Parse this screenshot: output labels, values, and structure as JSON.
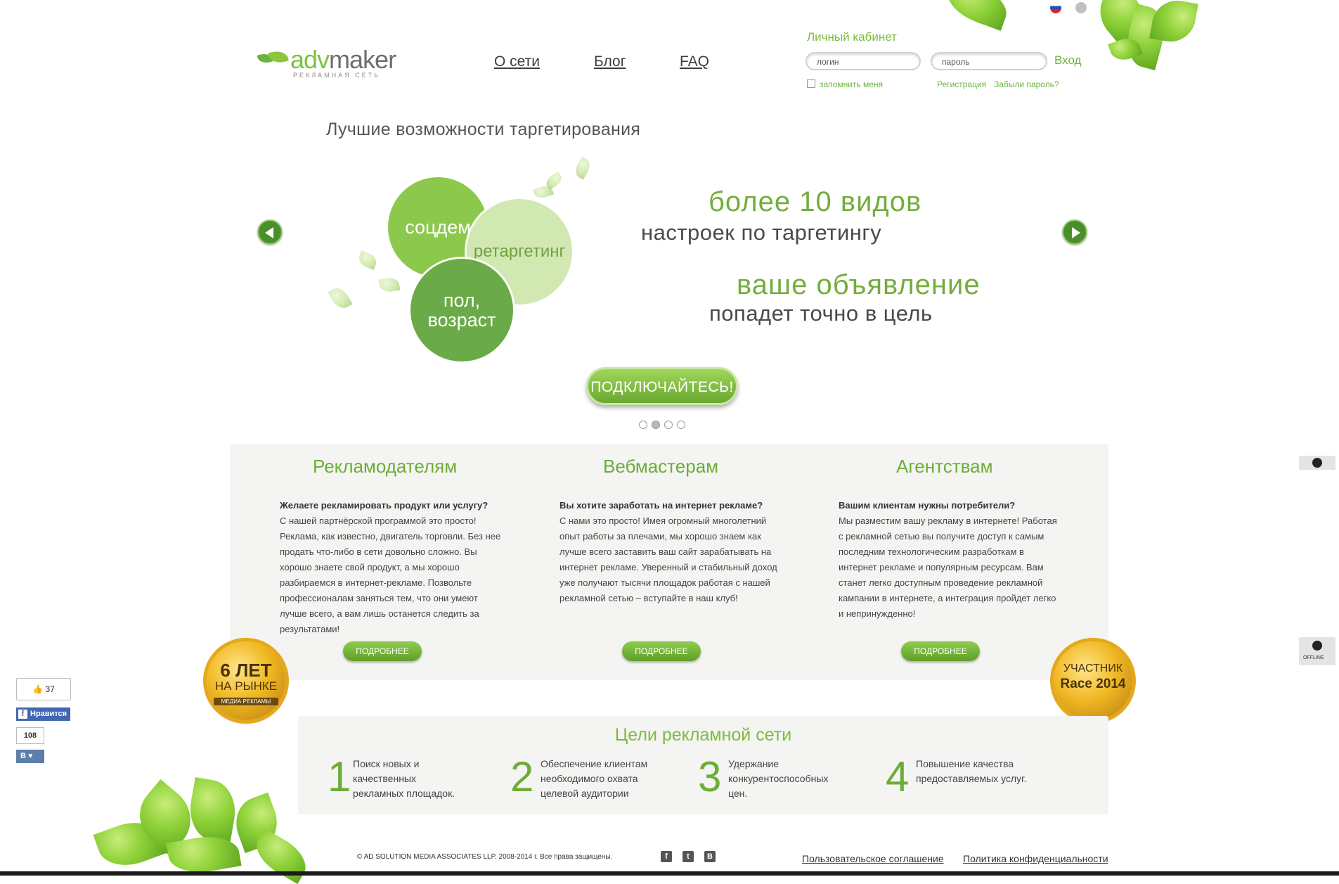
{
  "header": {
    "logo_main_a": "adv",
    "logo_main_b": "maker",
    "logo_sub": "РЕКЛАМНАЯ СЕТЬ",
    "nav": [
      "О сети",
      "Блог",
      "FAQ"
    ],
    "cabinet_title": "Личный кабинет",
    "login_placeholder": "логин",
    "password_placeholder": "пароль",
    "login_button": "Вход",
    "remember": "запомнить меня",
    "register": "Регистрация",
    "forgot": "Забыли пароль?"
  },
  "hero": {
    "title": "Лучшие возможности таргетирования",
    "circles": [
      "соцдем",
      "ретаргетинг",
      "пол,\nвозраст"
    ],
    "line1_big": "более 10 видов",
    "line1_small": "настроек по таргетингу",
    "line2_big": "ваше объявление",
    "line2_small": "попадет точно в цель",
    "cta": "ПОДКЛЮЧАЙТЕСЬ!",
    "slides_total": 4,
    "slide_active": 2
  },
  "columns": [
    {
      "title": "Рекламодателям",
      "lead": "Желаете рекламировать продукт или услугу?",
      "text": "С нашей партнёрской программой это просто! Реклама, как известно, двигатель торговли. Без нее продать что-либо в сети довольно сложно. Вы хорошо знаете свой продукт, а мы хорошо разбираемся в интернет-рекламе. Позвольте профессионалам заняться тем, что они умеют лучше всего, а вам лишь останется следить за результатами!",
      "button": "ПОДРОБНЕЕ"
    },
    {
      "title": "Вебмастерам",
      "lead": "Вы хотите заработать на интернет рекламе?",
      "text": "С нами это просто! Имея огромный многолетний опыт работы за плечами, мы хорошо знаем как лучше всего заставить ваш сайт зарабатывать на интернет рекламе. Уверенный и стабильный доход уже получают тысячи площадок работая с нашей рекламной сетью – вступайте в наш клуб!",
      "button": "ПОДРОБНЕЕ"
    },
    {
      "title": "Агентствам",
      "lead": "Вашим клиентам нужны потребители?",
      "text": "Мы разместим вашу рекламу в интернете! Работая с рекламной сетью вы получите доступ к самым последним технологическим разработкам в интернет рекламе и популярным ресурсам. Вам станет легко доступным проведение рекламной кампании в интернете, а интеграция пройдет легко и непринужденно!",
      "button": "ПОДРОБНЕЕ"
    }
  ],
  "badges": {
    "left_line1": "6 ЛЕТ",
    "left_line2": "НА РЫНКЕ",
    "left_ribbon": "МЕДИА РЕКЛАМЫ",
    "right_line1": "УЧАСТНИК",
    "right_line2": "Race 2014"
  },
  "goals": {
    "title": "Цели рекламной сети",
    "items": [
      {
        "num": "1",
        "text": "Поиск новых и качественных рекламных площадок."
      },
      {
        "num": "2",
        "text": "Обеспечение клиентам необходимого охвата целевой аудитории"
      },
      {
        "num": "3",
        "text": "Удержание конкурентоспособных цен."
      },
      {
        "num": "4",
        "text": "Повышение качества предоставляемых услуг."
      }
    ]
  },
  "social": {
    "fb_count": "37",
    "fb_like": "Нравится",
    "vk_count": "108",
    "vk_label": "В"
  },
  "chat": {
    "offline": "OFFLINE"
  },
  "footer": {
    "copyright": "© AD SOLUTION MEDIA ASSOCIATES LLP, 2008-2014 г. Все права защищены.",
    "social_icons": [
      "facebook-icon",
      "twitter-icon",
      "vk-icon"
    ],
    "agreement": "Пользовательское соглашение",
    "privacy": "Политика конфиденциальности"
  },
  "colors": {
    "brand_green": "#7cbd3a",
    "dark_green": "#4a8f2a",
    "panel_bg": "#f4f4f2"
  }
}
